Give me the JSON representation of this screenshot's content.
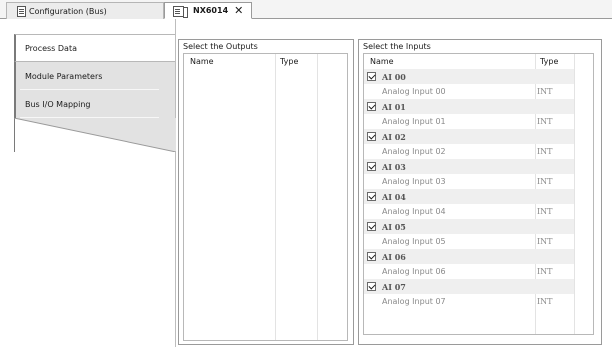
{
  "tabs": [
    {
      "label": "Configuration (Bus)"
    },
    {
      "label": "NX6014",
      "close": "✕"
    }
  ],
  "nav": {
    "items": [
      {
        "label": "Process Data"
      },
      {
        "label": "Module Parameters"
      },
      {
        "label": "Bus I/O Mapping"
      }
    ]
  },
  "outputs": {
    "title": "Select the Outputs",
    "col_name": "Name",
    "col_type": "Type"
  },
  "inputs": {
    "title": "Select the Inputs",
    "col_name": "Name",
    "col_type": "Type",
    "rows": [
      {
        "name": "AI 00",
        "desc": "Analog Input 00",
        "type": "INT",
        "checked": true
      },
      {
        "name": "AI 01",
        "desc": "Analog Input 01",
        "type": "INT",
        "checked": true
      },
      {
        "name": "AI 02",
        "desc": "Analog Input 02",
        "type": "INT",
        "checked": true
      },
      {
        "name": "AI 03",
        "desc": "Analog Input 03",
        "type": "INT",
        "checked": true
      },
      {
        "name": "AI 04",
        "desc": "Analog Input 04",
        "type": "INT",
        "checked": true
      },
      {
        "name": "AI 05",
        "desc": "Analog Input 05",
        "type": "INT",
        "checked": true
      },
      {
        "name": "AI 06",
        "desc": "Analog Input 06",
        "type": "INT",
        "checked": true
      },
      {
        "name": "AI 07",
        "desc": "Analog Input 07",
        "type": "INT",
        "checked": true
      }
    ]
  }
}
